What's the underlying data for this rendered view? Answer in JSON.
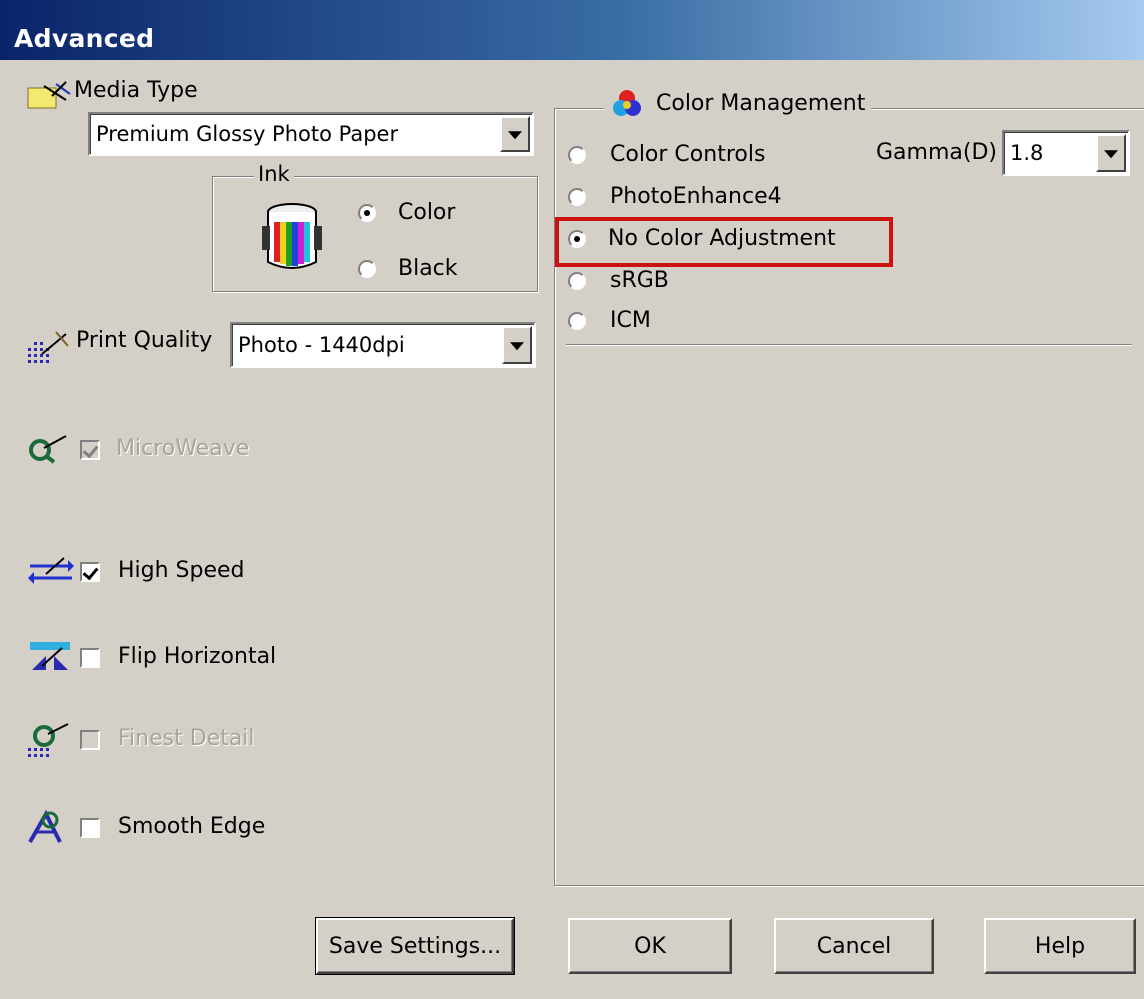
{
  "window": {
    "title": "Advanced"
  },
  "media_type": {
    "label": "Media Type",
    "value": "Premium Glossy Photo Paper",
    "icon": "media-type-icon"
  },
  "ink": {
    "label": "Ink",
    "options": [
      {
        "label": "Color",
        "selected": true
      },
      {
        "label": "Black",
        "selected": false
      }
    ]
  },
  "print_quality": {
    "label": "Print Quality",
    "value": "Photo - 1440dpi"
  },
  "options": {
    "microweave": {
      "label": "MicroWeave",
      "checked": true,
      "enabled": false
    },
    "high_speed": {
      "label": "High Speed",
      "checked": true,
      "enabled": true
    },
    "flip_horizontal": {
      "label": "Flip Horizontal",
      "checked": false,
      "enabled": true
    },
    "finest_detail": {
      "label": "Finest Detail",
      "checked": false,
      "enabled": false
    },
    "smooth_edge": {
      "label": "Smooth Edge",
      "checked": false,
      "enabled": true
    }
  },
  "color_management": {
    "label": "Color Management",
    "gamma_label": "Gamma(D)",
    "gamma_value": "1.8",
    "options": [
      {
        "label": "Color Controls",
        "selected": false
      },
      {
        "label": "PhotoEnhance4",
        "selected": false
      },
      {
        "label": "No Color Adjustment",
        "selected": true
      },
      {
        "label": "sRGB",
        "selected": false
      },
      {
        "label": "ICM",
        "selected": false
      }
    ]
  },
  "buttons": {
    "save_settings": "Save Settings...",
    "ok": "OK",
    "cancel": "Cancel",
    "help": "Help"
  },
  "colors": {
    "highlight": "#cc1111",
    "titlebar": "#0a246a",
    "face": "#d4d0c8"
  }
}
